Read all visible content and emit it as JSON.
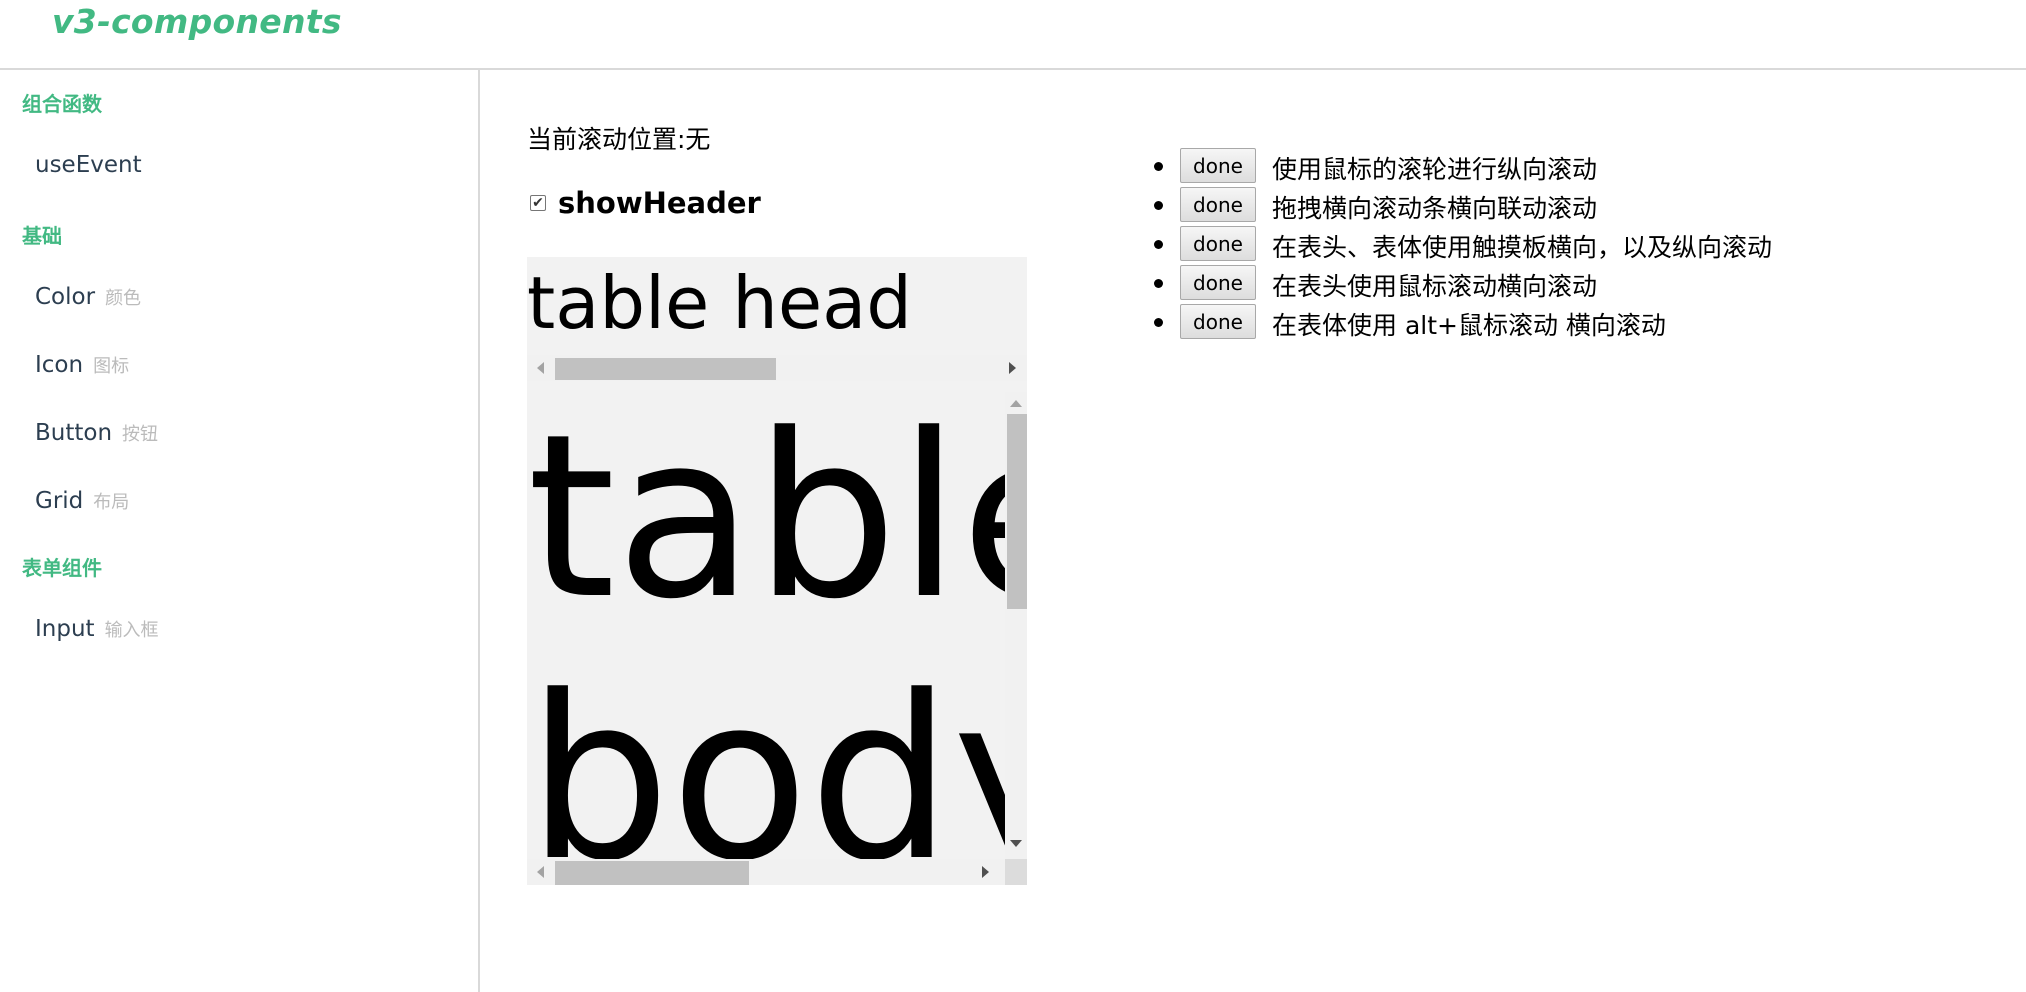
{
  "header": {
    "title": "v3-components"
  },
  "sidebar": {
    "groups": [
      {
        "title": "组合函数"
      },
      {
        "title": "基础"
      },
      {
        "title": "表单组件"
      }
    ],
    "items": [
      {
        "label": "useEvent",
        "sub": ""
      },
      {
        "label": "Color",
        "sub": "颜色"
      },
      {
        "label": "Icon",
        "sub": "图标"
      },
      {
        "label": "Button",
        "sub": "按钮"
      },
      {
        "label": "Grid",
        "sub": "布局"
      },
      {
        "label": "Input",
        "sub": "输入框"
      }
    ]
  },
  "main": {
    "scroll_position": "当前滚动位置:无",
    "show_header_label": "showHeader",
    "show_header_checked": true,
    "table_head": "table head",
    "table_body": "table body",
    "tasks": [
      {
        "button": "done",
        "text": "使用鼠标的滚轮进行纵向滚动"
      },
      {
        "button": "done",
        "text": "拖拽横向滚动条横向联动滚动"
      },
      {
        "button": "done",
        "text": "在表头、表体使用触摸板横向，以及纵向滚动"
      },
      {
        "button": "done",
        "text": "在表头使用鼠标滚动横向滚动"
      },
      {
        "button": "done",
        "text": "在表体使用 alt+鼠标滚动 横向滚动"
      }
    ]
  },
  "colors": {
    "accent": "#42b983",
    "sub_text": "#bbbbbb",
    "table_bg": "#f2f2f2",
    "scroll_thumb": "#c1c1c1"
  },
  "icons": [
    "checkbox-checked-icon",
    "arrow-left-icon",
    "arrow-right-icon",
    "arrow-up-icon",
    "arrow-down-icon",
    "mouse-cursor-icon"
  ]
}
